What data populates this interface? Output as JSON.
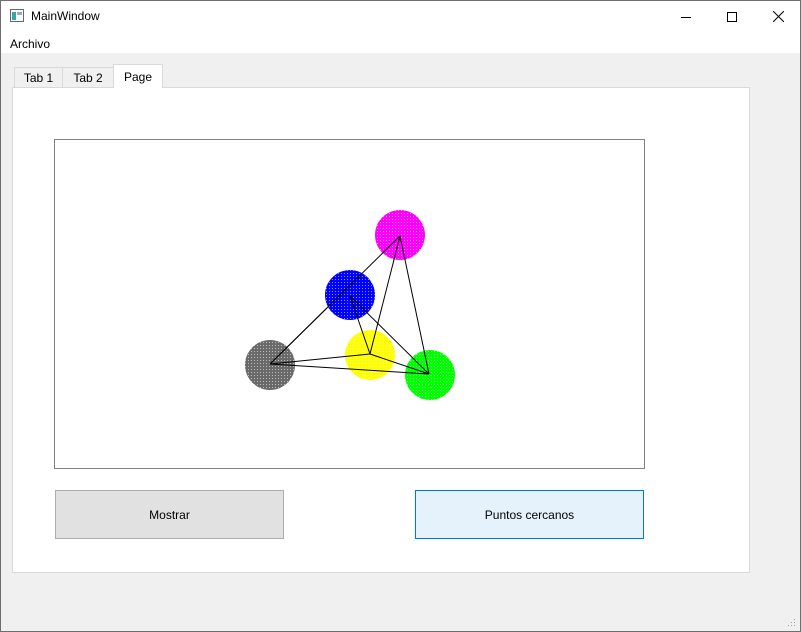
{
  "window": {
    "title": "MainWindow",
    "icon": "app-window-icon",
    "controls": [
      "minimize-icon",
      "maximize-icon",
      "close-icon"
    ]
  },
  "menu": {
    "items": [
      {
        "label": "Archivo"
      }
    ]
  },
  "tabs": [
    {
      "label": "Tab 1"
    },
    {
      "label": "Tab 2"
    },
    {
      "label": "Page",
      "active": true
    }
  ],
  "canvas": {
    "points": [
      {
        "name": "magenta",
        "color": "#ff00ff"
      },
      {
        "name": "blue",
        "color": "#0000ff"
      },
      {
        "name": "yellow",
        "color": "#ffff00"
      },
      {
        "name": "gray",
        "color": "#6a6a6a"
      },
      {
        "name": "green",
        "color": "#00ff00"
      }
    ],
    "connections": [
      [
        "gray",
        "magenta"
      ],
      [
        "gray",
        "blue"
      ],
      [
        "gray",
        "yellow"
      ],
      [
        "gray",
        "green"
      ],
      [
        "magenta",
        "yellow"
      ],
      [
        "magenta",
        "green"
      ],
      [
        "blue",
        "yellow"
      ],
      [
        "blue",
        "green"
      ],
      [
        "yellow",
        "green"
      ]
    ]
  },
  "buttons": {
    "mostrar": "Mostrar",
    "puntos_cercanos": "Puntos cercanos"
  }
}
